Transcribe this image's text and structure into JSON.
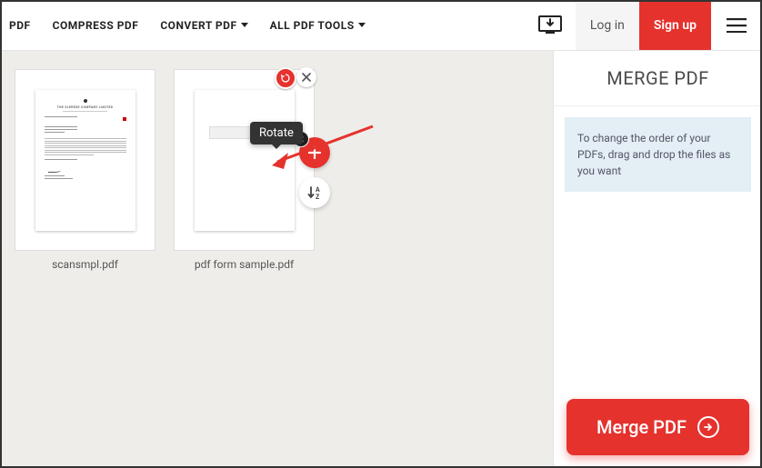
{
  "nav": {
    "items": [
      {
        "label": "PDF",
        "hasCaret": false
      },
      {
        "label": "COMPRESS PDF",
        "hasCaret": false
      },
      {
        "label": "CONVERT PDF",
        "hasCaret": true
      },
      {
        "label": "ALL PDF TOOLS",
        "hasCaret": true
      }
    ],
    "login_label": "Log in",
    "signup_label": "Sign up"
  },
  "workspace": {
    "files": [
      {
        "name": "scansmpl.pdf"
      },
      {
        "name": "pdf form sample.pdf"
      }
    ],
    "tooltip_label": "Rotate",
    "add_button_badge": "2"
  },
  "sidebar": {
    "title": "MERGE PDF",
    "hint": "To change the order of your PDFs, drag and drop the files as you want",
    "cta_label": "Merge PDF"
  }
}
